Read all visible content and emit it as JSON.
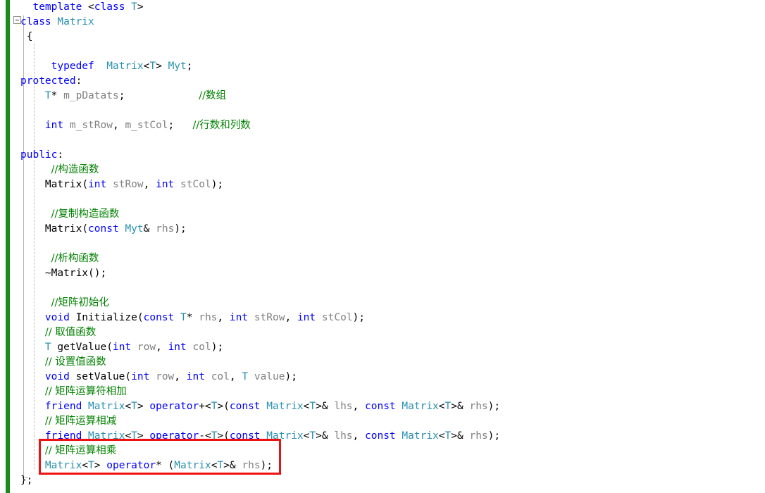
{
  "editor": {
    "language": "C++",
    "theme": "light",
    "colors": {
      "background": "#ffffff",
      "keyword": "#0000ff",
      "type": "#2b91af",
      "comment": "#008000",
      "identifier": "#808080",
      "punctuation": "#000000",
      "change_bar_saved": "#1a8a1a",
      "annotation": "#ee1111",
      "indent_guide": "#c0c0c0",
      "outline_rail": "#b4b4b4"
    },
    "outlining": {
      "collapse_toggle_label": "−",
      "collapse_target_line": 2
    },
    "annotation": {
      "shape": "rectangle",
      "color": "#ee1111",
      "highlights_lines": [
        30,
        31
      ]
    }
  },
  "code": {
    "lines": [
      {
        "n": 1,
        "tokens": [
          {
            "t": "  ",
            "c": "pun"
          },
          {
            "t": "template",
            "c": "kw"
          },
          {
            "t": " <",
            "c": "pun"
          },
          {
            "t": "class",
            "c": "kw"
          },
          {
            "t": " ",
            "c": "pun"
          },
          {
            "t": "T",
            "c": "typ"
          },
          {
            "t": ">",
            "c": "pun"
          }
        ]
      },
      {
        "n": 2,
        "tokens": [
          {
            "t": "class",
            "c": "kw"
          },
          {
            "t": " ",
            "c": "pun"
          },
          {
            "t": "Matrix",
            "c": "typ"
          }
        ]
      },
      {
        "n": 3,
        "tokens": [
          {
            "t": " {",
            "c": "pun"
          }
        ]
      },
      {
        "n": 4,
        "tokens": []
      },
      {
        "n": 5,
        "tokens": [
          {
            "t": "     ",
            "c": "pun"
          },
          {
            "t": "typedef",
            "c": "kw"
          },
          {
            "t": "  ",
            "c": "pun"
          },
          {
            "t": "Matrix",
            "c": "typ"
          },
          {
            "t": "<",
            "c": "pun"
          },
          {
            "t": "T",
            "c": "typ"
          },
          {
            "t": "> ",
            "c": "pun"
          },
          {
            "t": "Myt",
            "c": "typ"
          },
          {
            "t": ";",
            "c": "pun"
          }
        ]
      },
      {
        "n": 6,
        "tokens": [
          {
            "t": "protected",
            "c": "kw"
          },
          {
            "t": ":",
            "c": "pun"
          }
        ]
      },
      {
        "n": 7,
        "tokens": [
          {
            "t": "    ",
            "c": "pun"
          },
          {
            "t": "T",
            "c": "typ"
          },
          {
            "t": "* ",
            "c": "pun"
          },
          {
            "t": "m_pDatats",
            "c": "id"
          },
          {
            "t": ";            ",
            "c": "pun"
          },
          {
            "t": "//数组",
            "c": "cmt"
          }
        ]
      },
      {
        "n": 8,
        "tokens": []
      },
      {
        "n": 9,
        "tokens": [
          {
            "t": "    ",
            "c": "pun"
          },
          {
            "t": "int",
            "c": "kw"
          },
          {
            "t": " ",
            "c": "pun"
          },
          {
            "t": "m_stRow",
            "c": "id"
          },
          {
            "t": ", ",
            "c": "pun"
          },
          {
            "t": "m_stCol",
            "c": "id"
          },
          {
            "t": ";   ",
            "c": "pun"
          },
          {
            "t": "//行数和列数",
            "c": "cmt"
          }
        ]
      },
      {
        "n": 10,
        "tokens": []
      },
      {
        "n": 11,
        "tokens": [
          {
            "t": "public",
            "c": "kw"
          },
          {
            "t": ":",
            "c": "pun"
          }
        ]
      },
      {
        "n": 12,
        "tokens": [
          {
            "t": "     ",
            "c": "pun"
          },
          {
            "t": "//构造函数",
            "c": "cmt"
          }
        ]
      },
      {
        "n": 13,
        "tokens": [
          {
            "t": "    ",
            "c": "pun"
          },
          {
            "t": "Matrix",
            "c": "pun"
          },
          {
            "t": "(",
            "c": "pun"
          },
          {
            "t": "int",
            "c": "kw"
          },
          {
            "t": " ",
            "c": "pun"
          },
          {
            "t": "stRow",
            "c": "id"
          },
          {
            "t": ", ",
            "c": "pun"
          },
          {
            "t": "int",
            "c": "kw"
          },
          {
            "t": " ",
            "c": "pun"
          },
          {
            "t": "stCol",
            "c": "id"
          },
          {
            "t": ");",
            "c": "pun"
          }
        ]
      },
      {
        "n": 14,
        "tokens": []
      },
      {
        "n": 15,
        "tokens": [
          {
            "t": "     ",
            "c": "pun"
          },
          {
            "t": "//复制构造函数",
            "c": "cmt"
          }
        ]
      },
      {
        "n": 16,
        "tokens": [
          {
            "t": "    ",
            "c": "pun"
          },
          {
            "t": "Matrix",
            "c": "pun"
          },
          {
            "t": "(",
            "c": "pun"
          },
          {
            "t": "const",
            "c": "kw"
          },
          {
            "t": " ",
            "c": "pun"
          },
          {
            "t": "Myt",
            "c": "typ"
          },
          {
            "t": "& ",
            "c": "pun"
          },
          {
            "t": "rhs",
            "c": "id"
          },
          {
            "t": ");",
            "c": "pun"
          }
        ]
      },
      {
        "n": 17,
        "tokens": []
      },
      {
        "n": 18,
        "tokens": [
          {
            "t": "     ",
            "c": "pun"
          },
          {
            "t": "//析构函数",
            "c": "cmt"
          }
        ]
      },
      {
        "n": 19,
        "tokens": [
          {
            "t": "    ~",
            "c": "pun"
          },
          {
            "t": "Matrix",
            "c": "pun"
          },
          {
            "t": "();",
            "c": "pun"
          }
        ]
      },
      {
        "n": 20,
        "tokens": []
      },
      {
        "n": 21,
        "tokens": [
          {
            "t": "     ",
            "c": "pun"
          },
          {
            "t": "//矩阵初始化",
            "c": "cmt"
          }
        ]
      },
      {
        "n": 22,
        "tokens": [
          {
            "t": "    ",
            "c": "pun"
          },
          {
            "t": "void",
            "c": "kw"
          },
          {
            "t": " ",
            "c": "pun"
          },
          {
            "t": "Initialize",
            "c": "pun"
          },
          {
            "t": "(",
            "c": "pun"
          },
          {
            "t": "const",
            "c": "kw"
          },
          {
            "t": " ",
            "c": "pun"
          },
          {
            "t": "T",
            "c": "typ"
          },
          {
            "t": "* ",
            "c": "pun"
          },
          {
            "t": "rhs",
            "c": "id"
          },
          {
            "t": ", ",
            "c": "pun"
          },
          {
            "t": "int",
            "c": "kw"
          },
          {
            "t": " ",
            "c": "pun"
          },
          {
            "t": "stRow",
            "c": "id"
          },
          {
            "t": ", ",
            "c": "pun"
          },
          {
            "t": "int",
            "c": "kw"
          },
          {
            "t": " ",
            "c": "pun"
          },
          {
            "t": "stCol",
            "c": "id"
          },
          {
            "t": ");",
            "c": "pun"
          }
        ]
      },
      {
        "n": 23,
        "tokens": [
          {
            "t": "    ",
            "c": "pun"
          },
          {
            "t": "// 取值函数",
            "c": "cmt"
          }
        ]
      },
      {
        "n": 24,
        "tokens": [
          {
            "t": "    ",
            "c": "pun"
          },
          {
            "t": "T",
            "c": "typ"
          },
          {
            "t": " ",
            "c": "pun"
          },
          {
            "t": "getValue",
            "c": "pun"
          },
          {
            "t": "(",
            "c": "pun"
          },
          {
            "t": "int",
            "c": "kw"
          },
          {
            "t": " ",
            "c": "pun"
          },
          {
            "t": "row",
            "c": "id"
          },
          {
            "t": ", ",
            "c": "pun"
          },
          {
            "t": "int",
            "c": "kw"
          },
          {
            "t": " ",
            "c": "pun"
          },
          {
            "t": "col",
            "c": "id"
          },
          {
            "t": ");",
            "c": "pun"
          }
        ]
      },
      {
        "n": 25,
        "tokens": [
          {
            "t": "    ",
            "c": "pun"
          },
          {
            "t": "// 设置值函数",
            "c": "cmt"
          }
        ]
      },
      {
        "n": 26,
        "tokens": [
          {
            "t": "    ",
            "c": "pun"
          },
          {
            "t": "void",
            "c": "kw"
          },
          {
            "t": " ",
            "c": "pun"
          },
          {
            "t": "setValue",
            "c": "pun"
          },
          {
            "t": "(",
            "c": "pun"
          },
          {
            "t": "int",
            "c": "kw"
          },
          {
            "t": " ",
            "c": "pun"
          },
          {
            "t": "row",
            "c": "id"
          },
          {
            "t": ", ",
            "c": "pun"
          },
          {
            "t": "int",
            "c": "kw"
          },
          {
            "t": " ",
            "c": "pun"
          },
          {
            "t": "col",
            "c": "id"
          },
          {
            "t": ", ",
            "c": "pun"
          },
          {
            "t": "T",
            "c": "typ"
          },
          {
            "t": " ",
            "c": "pun"
          },
          {
            "t": "value",
            "c": "id"
          },
          {
            "t": ");",
            "c": "pun"
          }
        ]
      },
      {
        "n": 27,
        "tokens": [
          {
            "t": "    ",
            "c": "pun"
          },
          {
            "t": "// 矩阵运算符相加",
            "c": "cmt"
          }
        ]
      },
      {
        "n": 28,
        "tokens": [
          {
            "t": "    ",
            "c": "pun"
          },
          {
            "t": "friend",
            "c": "kw"
          },
          {
            "t": " ",
            "c": "pun"
          },
          {
            "t": "Matrix",
            "c": "typ"
          },
          {
            "t": "<",
            "c": "pun"
          },
          {
            "t": "T",
            "c": "typ"
          },
          {
            "t": "> ",
            "c": "pun"
          },
          {
            "t": "operator",
            "c": "kw"
          },
          {
            "t": "+<",
            "c": "pun"
          },
          {
            "t": "T",
            "c": "typ"
          },
          {
            "t": ">(",
            "c": "pun"
          },
          {
            "t": "const",
            "c": "kw"
          },
          {
            "t": " ",
            "c": "pun"
          },
          {
            "t": "Matrix",
            "c": "typ"
          },
          {
            "t": "<",
            "c": "pun"
          },
          {
            "t": "T",
            "c": "typ"
          },
          {
            "t": ">& ",
            "c": "pun"
          },
          {
            "t": "lhs",
            "c": "id"
          },
          {
            "t": ", ",
            "c": "pun"
          },
          {
            "t": "const",
            "c": "kw"
          },
          {
            "t": " ",
            "c": "pun"
          },
          {
            "t": "Matrix",
            "c": "typ"
          },
          {
            "t": "<",
            "c": "pun"
          },
          {
            "t": "T",
            "c": "typ"
          },
          {
            "t": ">& ",
            "c": "pun"
          },
          {
            "t": "rhs",
            "c": "id"
          },
          {
            "t": ");",
            "c": "pun"
          }
        ]
      },
      {
        "n": 29,
        "tokens": [
          {
            "t": "    ",
            "c": "pun"
          },
          {
            "t": "// 矩阵运算相减",
            "c": "cmt"
          }
        ]
      },
      {
        "n": 30,
        "tokens": [
          {
            "t": "    ",
            "c": "pun"
          },
          {
            "t": "friend",
            "c": "kw"
          },
          {
            "t": " ",
            "c": "pun"
          },
          {
            "t": "Matrix",
            "c": "typ"
          },
          {
            "t": "<",
            "c": "pun"
          },
          {
            "t": "T",
            "c": "typ"
          },
          {
            "t": "> ",
            "c": "pun"
          },
          {
            "t": "operator",
            "c": "kw"
          },
          {
            "t": "-<",
            "c": "pun"
          },
          {
            "t": "T",
            "c": "typ"
          },
          {
            "t": ">(",
            "c": "pun"
          },
          {
            "t": "const",
            "c": "kw"
          },
          {
            "t": " ",
            "c": "pun"
          },
          {
            "t": "Matrix",
            "c": "typ"
          },
          {
            "t": "<",
            "c": "pun"
          },
          {
            "t": "T",
            "c": "typ"
          },
          {
            "t": ">& ",
            "c": "pun"
          },
          {
            "t": "lhs",
            "c": "id"
          },
          {
            "t": ", ",
            "c": "pun"
          },
          {
            "t": "const",
            "c": "kw"
          },
          {
            "t": " ",
            "c": "pun"
          },
          {
            "t": "Matrix",
            "c": "typ"
          },
          {
            "t": "<",
            "c": "pun"
          },
          {
            "t": "T",
            "c": "typ"
          },
          {
            "t": ">& ",
            "c": "pun"
          },
          {
            "t": "rhs",
            "c": "id"
          },
          {
            "t": ");",
            "c": "pun"
          }
        ]
      },
      {
        "n": 31,
        "tokens": [
          {
            "t": "    ",
            "c": "pun"
          },
          {
            "t": "// 矩阵运算相乘",
            "c": "cmt"
          }
        ]
      },
      {
        "n": 32,
        "tokens": [
          {
            "t": "    ",
            "c": "pun"
          },
          {
            "t": "Matrix",
            "c": "typ"
          },
          {
            "t": "<",
            "c": "pun"
          },
          {
            "t": "T",
            "c": "typ"
          },
          {
            "t": "> ",
            "c": "pun"
          },
          {
            "t": "operator",
            "c": "kw"
          },
          {
            "t": "* (",
            "c": "pun"
          },
          {
            "t": "Matrix",
            "c": "typ"
          },
          {
            "t": "<",
            "c": "pun"
          },
          {
            "t": "T",
            "c": "typ"
          },
          {
            "t": ">& ",
            "c": "pun"
          },
          {
            "t": "rhs",
            "c": "id"
          },
          {
            "t": ");",
            "c": "pun"
          }
        ]
      },
      {
        "n": 33,
        "tokens": [
          {
            "t": "};",
            "c": "pun"
          }
        ]
      }
    ],
    "plain_text": "  template <class T>\nclass Matrix\n {\n\n     typedef  Matrix<T> Myt;\nprotected:\n    T* m_pDatats;            //数组\n\n    int m_stRow, m_stCol;   //行数和列数\n\npublic:\n     //构造函数\n    Matrix(int stRow, int stCol);\n\n     //复制构造函数\n    Matrix(const Myt& rhs);\n\n     //析构函数\n    ~Matrix();\n\n     //矩阵初始化\n    void Initialize(const T* rhs, int stRow, int stCol);\n    // 取值函数\n    T getValue(int row, int col);\n    // 设置值函数\n    void setValue(int row, int col, T value);\n    // 矩阵运算符相加\n    friend Matrix<T> operator+<T>(const Matrix<T>& lhs, const Matrix<T>& rhs);\n    // 矩阵运算相减\n    friend Matrix<T> operator-<T>(const Matrix<T>& lhs, const Matrix<T>& rhs);\n    // 矩阵运算相乘\n    Matrix<T> operator* (Matrix<T>& rhs);\n};"
  }
}
